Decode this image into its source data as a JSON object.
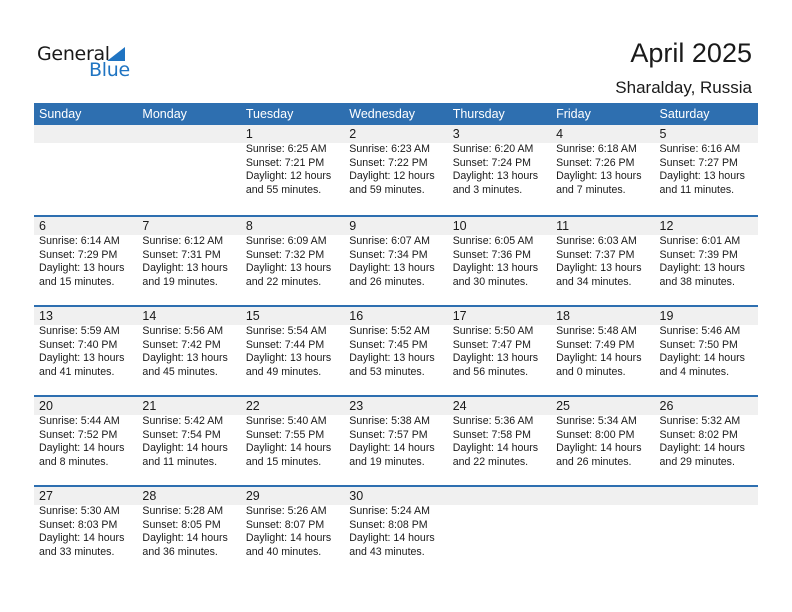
{
  "logo": {
    "word1": "General",
    "word2": "Blue",
    "icon": "triangle-flag-icon"
  },
  "header": {
    "title": "April 2025",
    "location": "Sharalday, Russia"
  },
  "colors": {
    "accent": "#2e6fb0",
    "band": "#f0f0f0",
    "logo_blue": "#1f74c2"
  },
  "weekdays": [
    "Sunday",
    "Monday",
    "Tuesday",
    "Wednesday",
    "Thursday",
    "Friday",
    "Saturday"
  ],
  "weeks": [
    [
      null,
      null,
      {
        "day": "1",
        "sunrise": "Sunrise: 6:25 AM",
        "sunset": "Sunset: 7:21 PM",
        "daylight1": "Daylight: 12 hours",
        "daylight2": "and 55 minutes."
      },
      {
        "day": "2",
        "sunrise": "Sunrise: 6:23 AM",
        "sunset": "Sunset: 7:22 PM",
        "daylight1": "Daylight: 12 hours",
        "daylight2": "and 59 minutes."
      },
      {
        "day": "3",
        "sunrise": "Sunrise: 6:20 AM",
        "sunset": "Sunset: 7:24 PM",
        "daylight1": "Daylight: 13 hours",
        "daylight2": "and 3 minutes."
      },
      {
        "day": "4",
        "sunrise": "Sunrise: 6:18 AM",
        "sunset": "Sunset: 7:26 PM",
        "daylight1": "Daylight: 13 hours",
        "daylight2": "and 7 minutes."
      },
      {
        "day": "5",
        "sunrise": "Sunrise: 6:16 AM",
        "sunset": "Sunset: 7:27 PM",
        "daylight1": "Daylight: 13 hours",
        "daylight2": "and 11 minutes."
      }
    ],
    [
      {
        "day": "6",
        "sunrise": "Sunrise: 6:14 AM",
        "sunset": "Sunset: 7:29 PM",
        "daylight1": "Daylight: 13 hours",
        "daylight2": "and 15 minutes."
      },
      {
        "day": "7",
        "sunrise": "Sunrise: 6:12 AM",
        "sunset": "Sunset: 7:31 PM",
        "daylight1": "Daylight: 13 hours",
        "daylight2": "and 19 minutes."
      },
      {
        "day": "8",
        "sunrise": "Sunrise: 6:09 AM",
        "sunset": "Sunset: 7:32 PM",
        "daylight1": "Daylight: 13 hours",
        "daylight2": "and 22 minutes."
      },
      {
        "day": "9",
        "sunrise": "Sunrise: 6:07 AM",
        "sunset": "Sunset: 7:34 PM",
        "daylight1": "Daylight: 13 hours",
        "daylight2": "and 26 minutes."
      },
      {
        "day": "10",
        "sunrise": "Sunrise: 6:05 AM",
        "sunset": "Sunset: 7:36 PM",
        "daylight1": "Daylight: 13 hours",
        "daylight2": "and 30 minutes."
      },
      {
        "day": "11",
        "sunrise": "Sunrise: 6:03 AM",
        "sunset": "Sunset: 7:37 PM",
        "daylight1": "Daylight: 13 hours",
        "daylight2": "and 34 minutes."
      },
      {
        "day": "12",
        "sunrise": "Sunrise: 6:01 AM",
        "sunset": "Sunset: 7:39 PM",
        "daylight1": "Daylight: 13 hours",
        "daylight2": "and 38 minutes."
      }
    ],
    [
      {
        "day": "13",
        "sunrise": "Sunrise: 5:59 AM",
        "sunset": "Sunset: 7:40 PM",
        "daylight1": "Daylight: 13 hours",
        "daylight2": "and 41 minutes."
      },
      {
        "day": "14",
        "sunrise": "Sunrise: 5:56 AM",
        "sunset": "Sunset: 7:42 PM",
        "daylight1": "Daylight: 13 hours",
        "daylight2": "and 45 minutes."
      },
      {
        "day": "15",
        "sunrise": "Sunrise: 5:54 AM",
        "sunset": "Sunset: 7:44 PM",
        "daylight1": "Daylight: 13 hours",
        "daylight2": "and 49 minutes."
      },
      {
        "day": "16",
        "sunrise": "Sunrise: 5:52 AM",
        "sunset": "Sunset: 7:45 PM",
        "daylight1": "Daylight: 13 hours",
        "daylight2": "and 53 minutes."
      },
      {
        "day": "17",
        "sunrise": "Sunrise: 5:50 AM",
        "sunset": "Sunset: 7:47 PM",
        "daylight1": "Daylight: 13 hours",
        "daylight2": "and 56 minutes."
      },
      {
        "day": "18",
        "sunrise": "Sunrise: 5:48 AM",
        "sunset": "Sunset: 7:49 PM",
        "daylight1": "Daylight: 14 hours",
        "daylight2": "and 0 minutes."
      },
      {
        "day": "19",
        "sunrise": "Sunrise: 5:46 AM",
        "sunset": "Sunset: 7:50 PM",
        "daylight1": "Daylight: 14 hours",
        "daylight2": "and 4 minutes."
      }
    ],
    [
      {
        "day": "20",
        "sunrise": "Sunrise: 5:44 AM",
        "sunset": "Sunset: 7:52 PM",
        "daylight1": "Daylight: 14 hours",
        "daylight2": "and 8 minutes."
      },
      {
        "day": "21",
        "sunrise": "Sunrise: 5:42 AM",
        "sunset": "Sunset: 7:54 PM",
        "daylight1": "Daylight: 14 hours",
        "daylight2": "and 11 minutes."
      },
      {
        "day": "22",
        "sunrise": "Sunrise: 5:40 AM",
        "sunset": "Sunset: 7:55 PM",
        "daylight1": "Daylight: 14 hours",
        "daylight2": "and 15 minutes."
      },
      {
        "day": "23",
        "sunrise": "Sunrise: 5:38 AM",
        "sunset": "Sunset: 7:57 PM",
        "daylight1": "Daylight: 14 hours",
        "daylight2": "and 19 minutes."
      },
      {
        "day": "24",
        "sunrise": "Sunrise: 5:36 AM",
        "sunset": "Sunset: 7:58 PM",
        "daylight1": "Daylight: 14 hours",
        "daylight2": "and 22 minutes."
      },
      {
        "day": "25",
        "sunrise": "Sunrise: 5:34 AM",
        "sunset": "Sunset: 8:00 PM",
        "daylight1": "Daylight: 14 hours",
        "daylight2": "and 26 minutes."
      },
      {
        "day": "26",
        "sunrise": "Sunrise: 5:32 AM",
        "sunset": "Sunset: 8:02 PM",
        "daylight1": "Daylight: 14 hours",
        "daylight2": "and 29 minutes."
      }
    ],
    [
      {
        "day": "27",
        "sunrise": "Sunrise: 5:30 AM",
        "sunset": "Sunset: 8:03 PM",
        "daylight1": "Daylight: 14 hours",
        "daylight2": "and 33 minutes."
      },
      {
        "day": "28",
        "sunrise": "Sunrise: 5:28 AM",
        "sunset": "Sunset: 8:05 PM",
        "daylight1": "Daylight: 14 hours",
        "daylight2": "and 36 minutes."
      },
      {
        "day": "29",
        "sunrise": "Sunrise: 5:26 AM",
        "sunset": "Sunset: 8:07 PM",
        "daylight1": "Daylight: 14 hours",
        "daylight2": "and 40 minutes."
      },
      {
        "day": "30",
        "sunrise": "Sunrise: 5:24 AM",
        "sunset": "Sunset: 8:08 PM",
        "daylight1": "Daylight: 14 hours",
        "daylight2": "and 43 minutes."
      },
      null,
      null,
      null
    ]
  ]
}
